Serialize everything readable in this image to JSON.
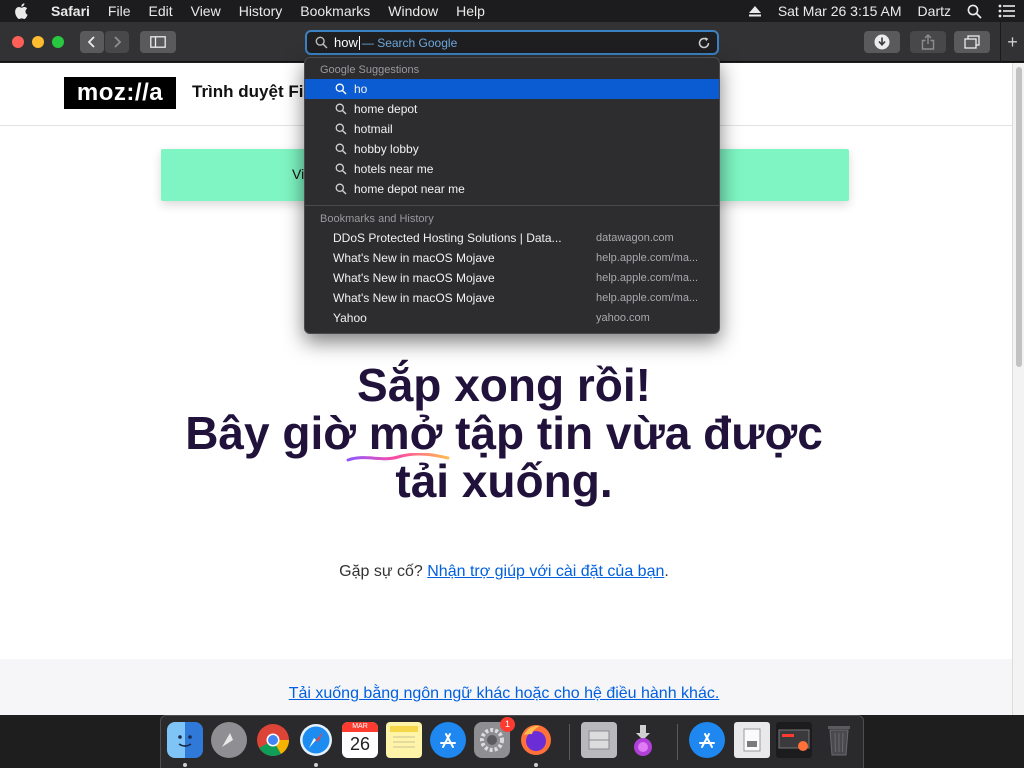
{
  "menubar": {
    "app_name": "Safari",
    "items": [
      "File",
      "Edit",
      "View",
      "History",
      "Bookmarks",
      "Window",
      "Help"
    ],
    "datetime": "Sat Mar 26  3:15 AM",
    "user": "Dartz"
  },
  "toolbar": {
    "address_typed": "how",
    "address_hint": "— Search Google"
  },
  "page": {
    "logo": "moz://a",
    "header_title": "Trình duyệt Firefox",
    "banner_text": "Vi",
    "headline_line1": "Sắp xong rồi!",
    "headline_line2": "Bây giờ mở tập tin vừa được",
    "headline_line3": "tải xuống.",
    "help_prefix": "Gặp sự cố?",
    "help_link": "Nhận trợ giúp với cài đặt của bạn",
    "help_suffix": ".",
    "footer_link": "Tải xuống bằng ngôn ngữ khác hoặc cho hệ điều hành khác."
  },
  "dropdown": {
    "suggestions_title": "Google Suggestions",
    "suggestions": [
      "ho",
      "home depot",
      "hotmail",
      "hobby lobby",
      "hotels near me",
      "home depot near me"
    ],
    "history_title": "Bookmarks and History",
    "history": [
      {
        "title": "DDoS Protected Hosting Solutions | Data...",
        "url": "datawagon.com"
      },
      {
        "title": "What's New in macOS Mojave",
        "url": "help.apple.com/ma..."
      },
      {
        "title": "What's New in macOS Mojave",
        "url": "help.apple.com/ma..."
      },
      {
        "title": "What's New in macOS Mojave",
        "url": "help.apple.com/ma..."
      },
      {
        "title": "Yahoo",
        "url": "yahoo.com"
      }
    ]
  },
  "dock": {
    "calendar_month": "MAR",
    "calendar_day": "26",
    "preferences_badge": "1"
  },
  "colors": {
    "selection": "#0b5bd3",
    "banner": "#7ff5c3",
    "headline": "#20123a",
    "link": "#0060df"
  }
}
